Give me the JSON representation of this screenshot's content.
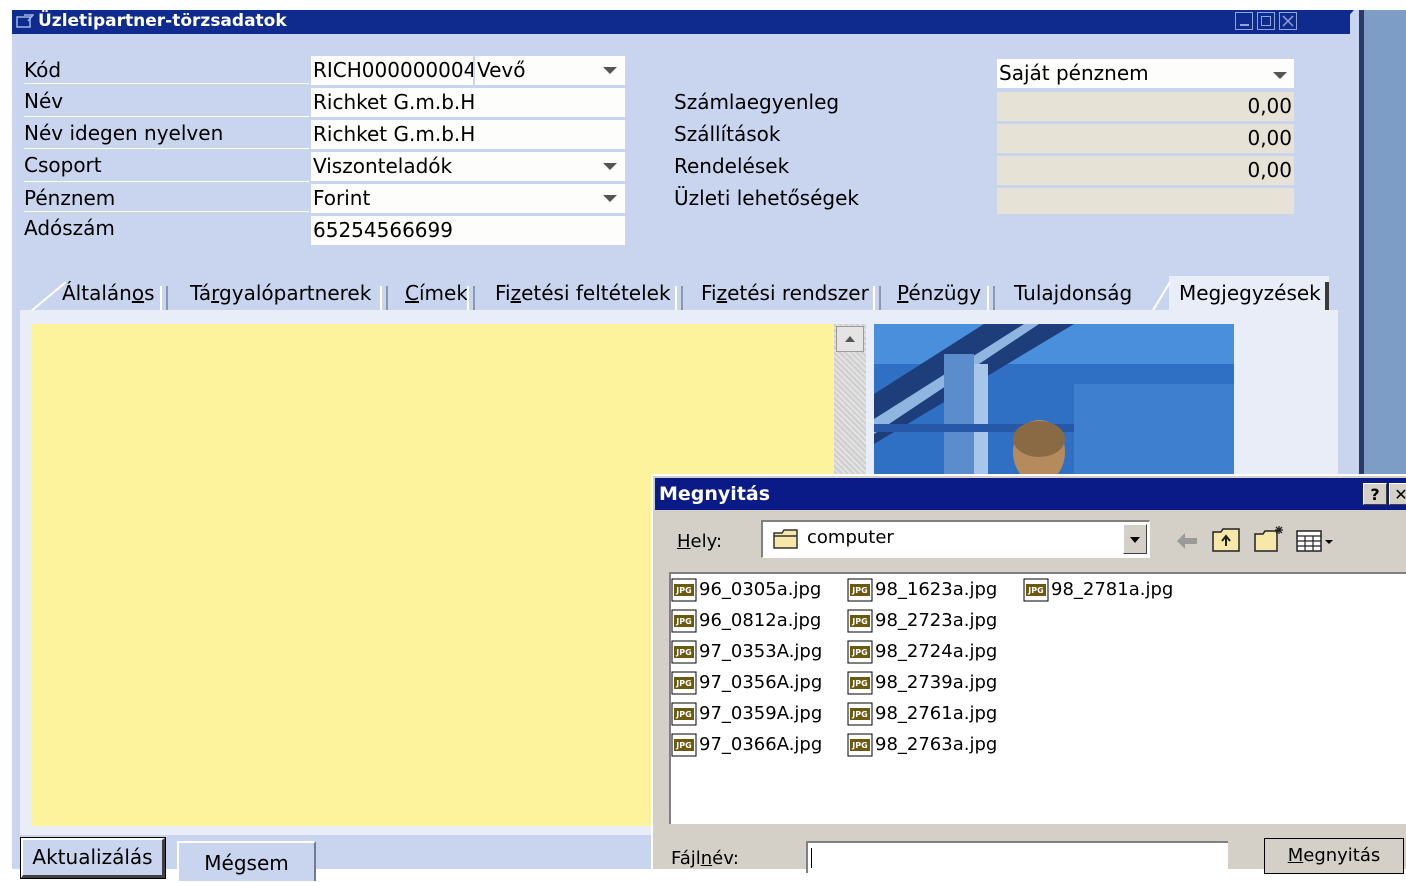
{
  "window": {
    "title": "Üzletipartner-törzsadatok"
  },
  "header_fields": [
    {
      "label": "Kód",
      "value": "RICH000000004"
    },
    {
      "label": "Név",
      "value": "Richket G.m.b.H"
    },
    {
      "label": "Név idegen nyelven",
      "value": "Richket G.m.b.H"
    },
    {
      "label": "Csoport",
      "value": "Viszonteladók"
    },
    {
      "label": "Pénznem",
      "value": "Forint"
    },
    {
      "label": "Adószám",
      "value": "65254566699"
    }
  ],
  "partner_type": "Vevő",
  "balance": {
    "currency_select": "Saját pénznem",
    "rows": [
      {
        "label": "Számlaegyenleg",
        "value": "0,00"
      },
      {
        "label": "Szállítások",
        "value": "0,00"
      },
      {
        "label": "Rendelések",
        "value": "0,00"
      },
      {
        "label": "Üzleti lehetőségek",
        "value": ""
      }
    ]
  },
  "tabs": [
    {
      "pre": "Általán",
      "key": "o",
      "post": "s"
    },
    {
      "pre": "Tá",
      "key": "r",
      "post": "gyalópartnerek"
    },
    {
      "pre": "",
      "key": "C",
      "post": "ímek"
    },
    {
      "pre": "Fi",
      "key": "z",
      "post": "etési feltételek"
    },
    {
      "pre": "Fi",
      "key": "z",
      "post": "etési rendszer"
    },
    {
      "pre": "",
      "key": "P",
      "post": "énzügy"
    },
    {
      "pre": "Tulajdonság",
      "key": "",
      "post": ""
    },
    {
      "pre": "Megjegyzések",
      "key": "",
      "post": ""
    }
  ],
  "buttons": {
    "update": "Aktualizálás",
    "cancel": "Mégsem"
  },
  "dialog": {
    "title": "Megnyitás",
    "help": "?",
    "close": "✕",
    "location_label_pre": "H",
    "location_label_key": "e",
    "location_label_post": "ly:",
    "location_value": "computer",
    "filename_label_pre": "Fájl",
    "filename_label_key": "n",
    "filename_label_post": "év:",
    "filename_value": "",
    "open_button_key": "M",
    "open_button_post": "egnyitás",
    "files": [
      [
        "96_0305a.jpg",
        "96_0812a.jpg",
        "97_0353A.jpg",
        "97_0356A.jpg",
        "97_0359A.jpg",
        "97_0366A.jpg"
      ],
      [
        "98_1623a.jpg",
        "98_2723a.jpg",
        "98_2724a.jpg",
        "98_2739a.jpg",
        "98_2761a.jpg",
        "98_2763a.jpg"
      ],
      [
        "98_2781a.jpg"
      ]
    ]
  }
}
